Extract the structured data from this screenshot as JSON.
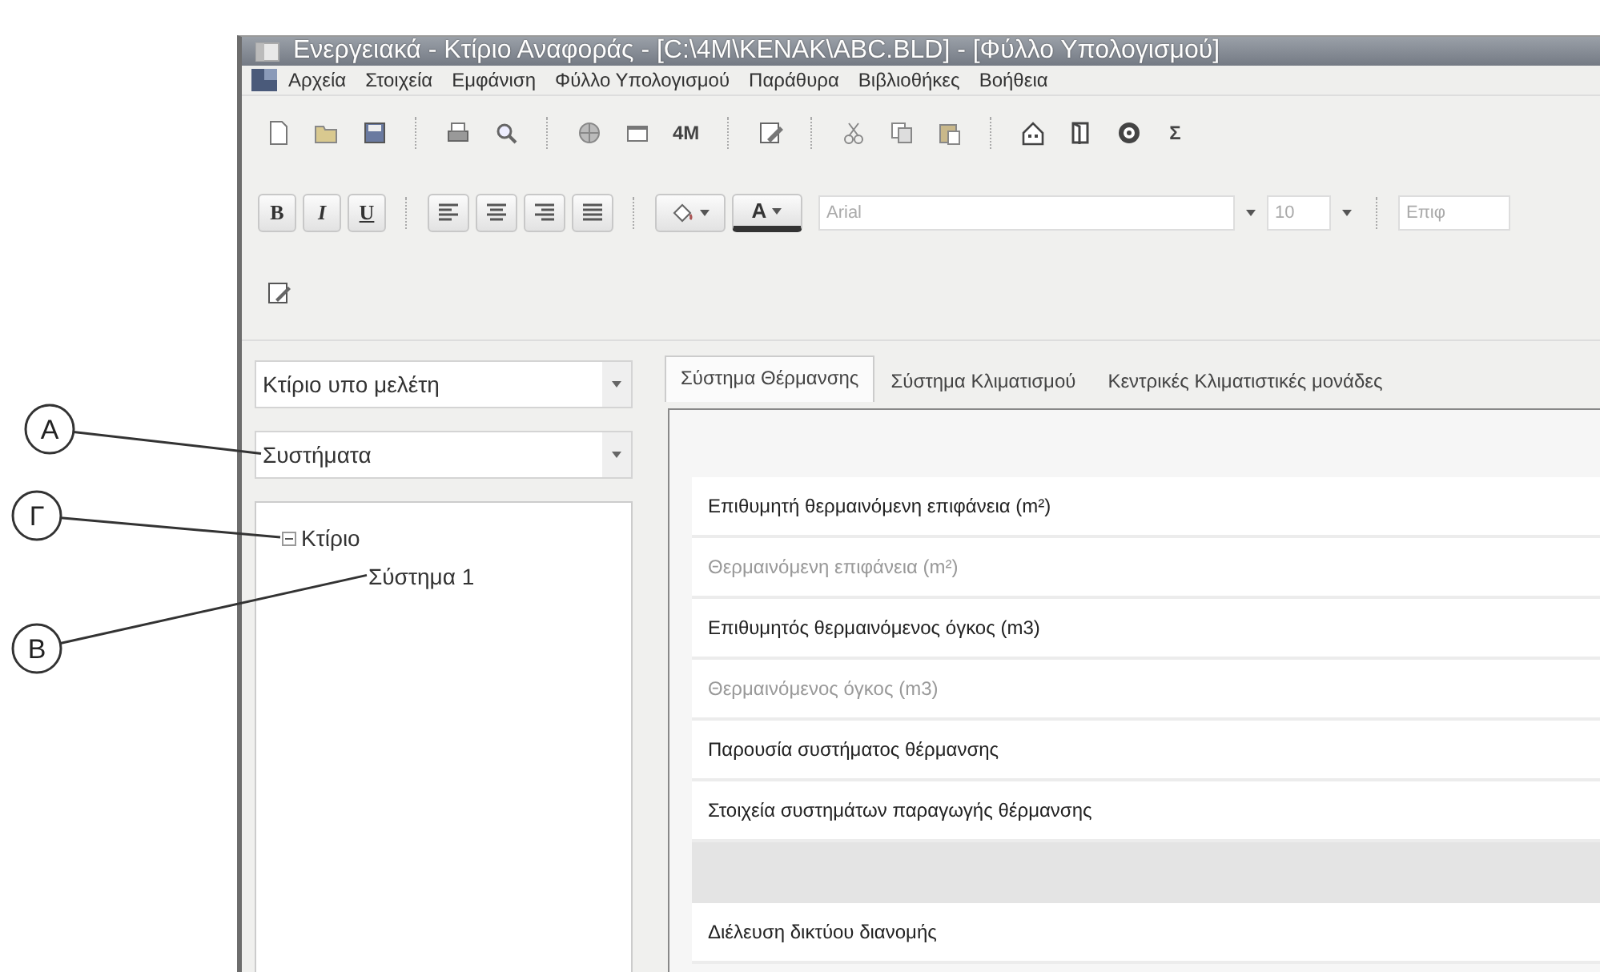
{
  "window": {
    "title": "Ενεργειακά - Κτίριο Αναφοράς - [C:\\4M\\KENAK\\ABC.BLD] - [Φύλλο Υπολογισμού]"
  },
  "menu": [
    "Αρχεία",
    "Στοιχεία",
    "Εμφάνιση",
    "Φύλλο Υπολογισμού",
    "Παράθυρα",
    "Βιβλιοθήκες",
    "Βοήθεια"
  ],
  "toolbar": {
    "text_buttons": [
      "4M",
      "Σ"
    ],
    "format_buttons": [
      "B",
      "I",
      "U"
    ],
    "font_color_button": "A",
    "font_field": "Arial",
    "size_field": "10",
    "style_field": "Επιφ"
  },
  "sidebar": {
    "combos": [
      "Κτίριο υπο μελέτη",
      "Συστήματα"
    ],
    "tree": [
      {
        "label": "Κτίριο",
        "expanded": true,
        "children": [
          {
            "label": "Σύστημα 1"
          }
        ]
      }
    ]
  },
  "tabs": [
    {
      "label": "Σύστημα Θέρμανσης",
      "selected": true
    },
    {
      "label": "Σύστημα Κλιματισμού",
      "selected": false
    },
    {
      "label": "Κεντρικές Κλιματιστικές μονάδες",
      "selected": false
    }
  ],
  "rows": [
    {
      "kind": "field",
      "label": "Επιθυμητή θερμαινόμενη επιφάνεια (m²)",
      "disabled": false
    },
    {
      "kind": "field",
      "label": "Θερμαινόμενη επιφάνεια (m²)",
      "disabled": true
    },
    {
      "kind": "field",
      "label": "Επιθυμητός θερμαινόμενος όγκος (m3)",
      "disabled": false
    },
    {
      "kind": "field",
      "label": "Θερμαινόμενος όγκος (m3)",
      "disabled": true
    },
    {
      "kind": "field",
      "label": "Παρουσία συστήματος θέρμανσης",
      "disabled": false
    },
    {
      "kind": "field",
      "label": "Στοιχεία συστημάτων παραγωγής θέρμανσης",
      "disabled": false
    },
    {
      "kind": "band"
    },
    {
      "kind": "field",
      "label": "Διέλευση δικτύου διανομής",
      "disabled": false
    }
  ],
  "callouts": [
    {
      "label": "Α",
      "kind": "combo"
    },
    {
      "label": "Γ",
      "kind": "toggle"
    },
    {
      "label": "Β",
      "kind": "child"
    }
  ]
}
